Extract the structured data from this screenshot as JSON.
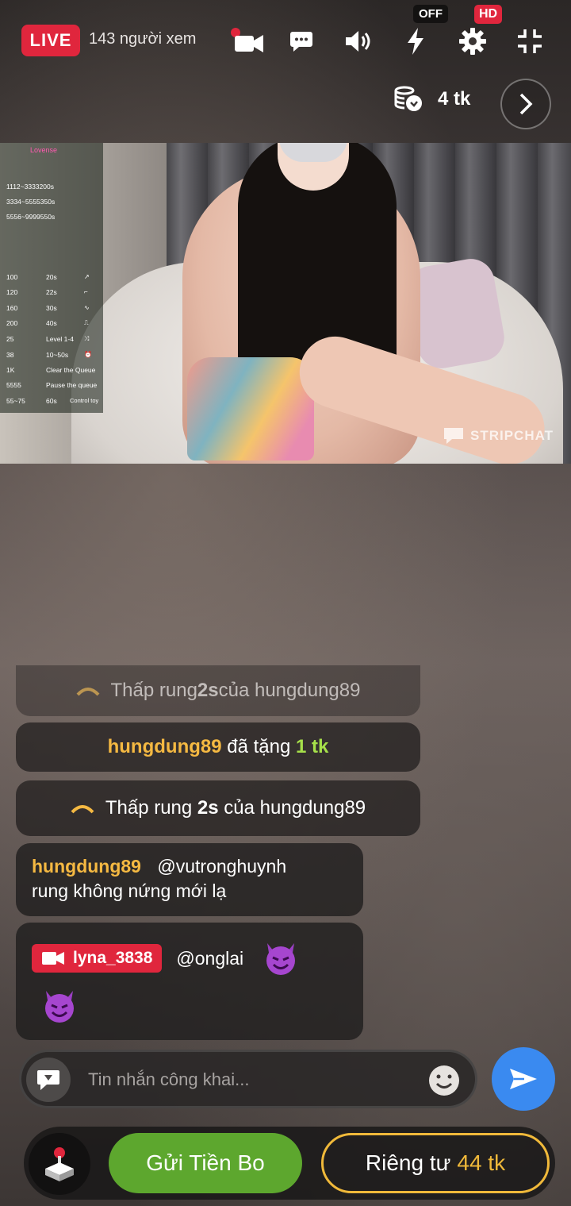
{
  "header": {
    "live_label": "LIVE",
    "viewers_text": "143 người xem",
    "lightning_badge": "OFF",
    "quality_badge": "HD",
    "icons": [
      "video-camera-icon",
      "chat-bubble-icon",
      "volume-icon",
      "lightning-icon",
      "gear-icon",
      "fullscreen-exit-icon"
    ]
  },
  "tokens": {
    "value": "4 tk",
    "icon": "coins-icon"
  },
  "video": {
    "watermark": "STRIPCHAT",
    "lovense": {
      "title": "Lovense",
      "ranges": [
        {
          "range": "1112~3333",
          "time": "200s"
        },
        {
          "range": "3334~5555",
          "time": "350s"
        },
        {
          "range": "5556~9999",
          "time": "550s"
        }
      ],
      "levels": [
        {
          "amount": "100",
          "action": "20s",
          "icon": "↗"
        },
        {
          "amount": "120",
          "action": "22s",
          "icon": "⌐"
        },
        {
          "amount": "160",
          "action": "30s",
          "icon": "∿"
        },
        {
          "amount": "200",
          "action": "40s",
          "icon": "⎍"
        },
        {
          "amount": "25",
          "action": "Level 1-4",
          "icon": "⤨"
        },
        {
          "amount": "38",
          "action": "10~50s",
          "icon": "⏰"
        },
        {
          "amount": "1K",
          "action": "Clear the Queue",
          "icon": ""
        },
        {
          "amount": "5555",
          "action": "Pause the queue",
          "icon": ""
        },
        {
          "amount": "55~75",
          "action": "60s",
          "icon": "Control toy"
        }
      ]
    }
  },
  "chat": {
    "messages": [
      {
        "type": "vibration",
        "text_before": "Thấp rung ",
        "bold": "2s",
        "text_after": " của hungdung89"
      },
      {
        "type": "tip",
        "user": "hungdung89",
        "middle": " đã tặng ",
        "amount": "1 tk"
      },
      {
        "type": "vibration",
        "text_before": "Thấp rung ",
        "bold": "2s",
        "text_after": " của hungdung89"
      },
      {
        "type": "message",
        "user": "hungdung89",
        "mention": "@vutronghuynh",
        "text": "rung không nứng mới lạ"
      },
      {
        "type": "model",
        "user": "lyna_3838",
        "mention": "@onglai"
      }
    ]
  },
  "input": {
    "placeholder": "Tin nhắn công khai..."
  },
  "actions": {
    "tip_label": "Gửi Tiền Bo",
    "private_label": "Riêng tư",
    "private_price": "44 tk"
  },
  "colors": {
    "live_red": "#e0263d",
    "tip_green": "#5da72e",
    "gold": "#f0b93a",
    "send_blue": "#3a8af0"
  }
}
